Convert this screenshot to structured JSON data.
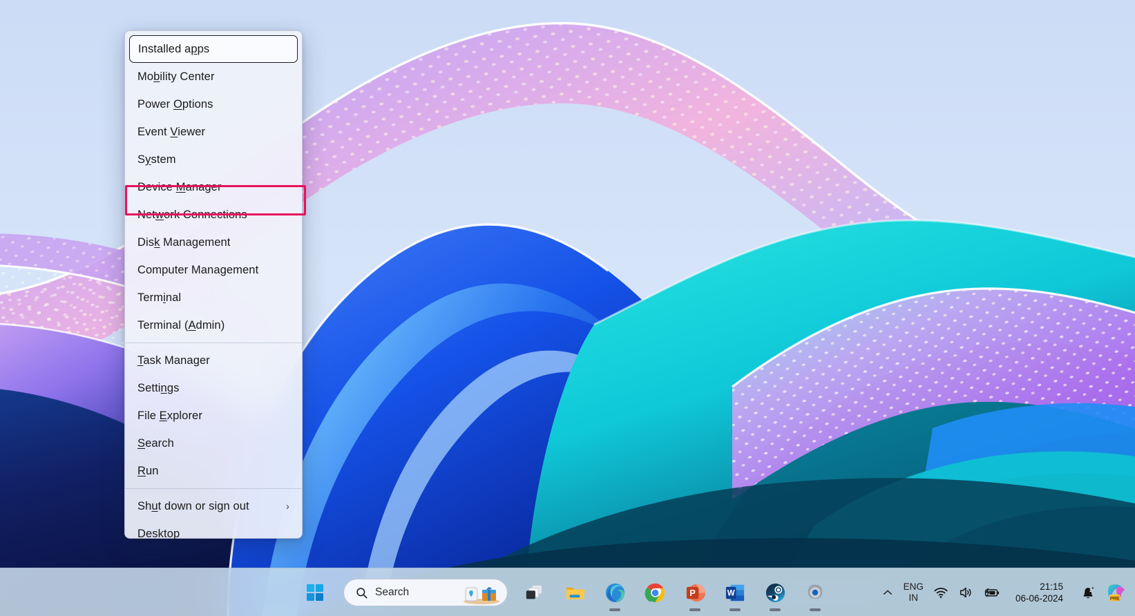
{
  "desktop": {
    "wallpaper_name": "windows-11-bloom-wallpaper",
    "colors": {
      "sky": "#ccdcf6",
      "cyan_wave": "#0fcbd9",
      "deep_teal": "#063d57",
      "royal_blue": "#1552e8",
      "purple_ribbon": "#a86bf0",
      "pink_ribbon": "#f0a8d8",
      "navy_left": "#111a52"
    }
  },
  "context_menu": {
    "name": "win-x-power-user-menu",
    "items": [
      {
        "label": "Installed apps",
        "accel": "p",
        "focused": true,
        "separator_after": false,
        "submenu": false
      },
      {
        "label": "Mobility Center",
        "accel": "b",
        "focused": false,
        "separator_after": false,
        "submenu": false
      },
      {
        "label": "Power Options",
        "accel": "O",
        "focused": false,
        "separator_after": false,
        "submenu": false
      },
      {
        "label": "Event Viewer",
        "accel": "V",
        "focused": false,
        "separator_after": false,
        "submenu": false
      },
      {
        "label": "System",
        "accel": "y",
        "focused": false,
        "separator_after": false,
        "submenu": false
      },
      {
        "label": "Device Manager",
        "accel": "M",
        "focused": false,
        "separator_after": false,
        "submenu": false,
        "highlighted": true
      },
      {
        "label": "Network Connections",
        "accel": "w",
        "focused": false,
        "separator_after": false,
        "submenu": false
      },
      {
        "label": "Disk Management",
        "accel": "k",
        "focused": false,
        "separator_after": false,
        "submenu": false
      },
      {
        "label": "Computer Management",
        "accel": "g",
        "focused": false,
        "separator_after": false,
        "submenu": false
      },
      {
        "label": "Terminal",
        "accel": "i",
        "focused": false,
        "separator_after": false,
        "submenu": false
      },
      {
        "label": "Terminal (Admin)",
        "accel": "A",
        "focused": false,
        "separator_after": true,
        "submenu": false
      },
      {
        "label": "Task Manager",
        "accel": "T",
        "focused": false,
        "separator_after": false,
        "submenu": false
      },
      {
        "label": "Settings",
        "accel": "n",
        "focused": false,
        "separator_after": false,
        "submenu": false
      },
      {
        "label": "File Explorer",
        "accel": "E",
        "focused": false,
        "separator_after": false,
        "submenu": false
      },
      {
        "label": "Search",
        "accel": "S",
        "focused": false,
        "separator_after": false,
        "submenu": false
      },
      {
        "label": "Run",
        "accel": "R",
        "focused": false,
        "separator_after": true,
        "submenu": false
      },
      {
        "label": "Shut down or sign out",
        "accel": "u",
        "focused": false,
        "separator_after": false,
        "submenu": true,
        "chevron": "›"
      },
      {
        "label": "Desktop",
        "accel": "D",
        "focused": false,
        "separator_after": false,
        "submenu": false
      }
    ],
    "annotation": {
      "target_label": "Device Manager",
      "color": "#e8115b",
      "style": "rectangle-outline"
    }
  },
  "taskbar": {
    "start_button": "start-button",
    "search": {
      "placeholder": "Search",
      "icon": "search-icon"
    },
    "apps": [
      {
        "name": "task-view",
        "label": "Task View",
        "running": false
      },
      {
        "name": "file-explorer",
        "label": "File Explorer",
        "running": false
      },
      {
        "name": "microsoft-edge",
        "label": "Microsoft Edge",
        "running": true
      },
      {
        "name": "google-chrome",
        "label": "Google Chrome",
        "running": false
      },
      {
        "name": "powerpoint",
        "label": "PowerPoint",
        "running": true
      },
      {
        "name": "word",
        "label": "Word",
        "running": true
      },
      {
        "name": "steam",
        "label": "Steam",
        "running": true
      },
      {
        "name": "settings",
        "label": "Settings",
        "running": true
      }
    ],
    "tray": {
      "show_hidden_icons": "chevron-up-icon",
      "language_line1": "ENG",
      "language_line2": "IN",
      "network": "wifi-icon",
      "volume": "speaker-icon",
      "battery": "battery-charging-icon",
      "time": "21:15",
      "date": "06-06-2024",
      "notification": "notification-bell-dnd-icon",
      "copilot_badge": "PRE"
    }
  }
}
